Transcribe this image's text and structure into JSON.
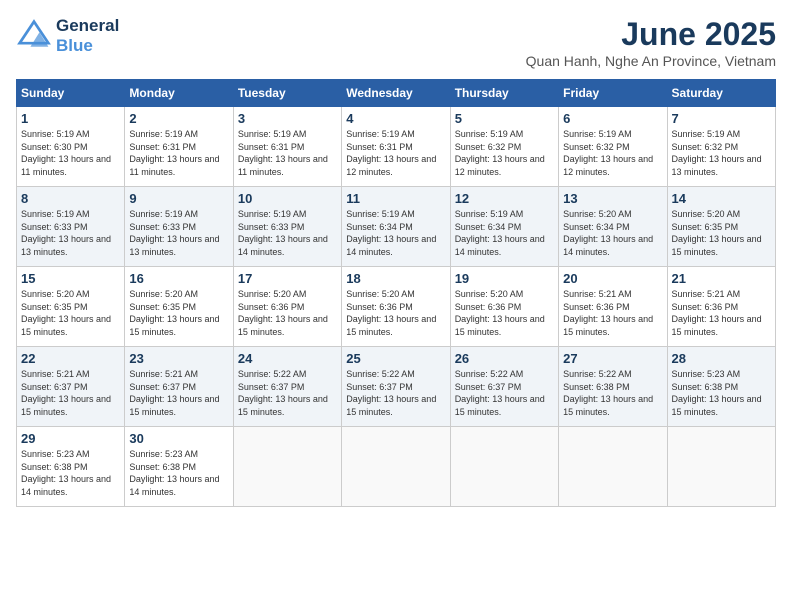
{
  "header": {
    "logo_line1": "General",
    "logo_line2": "Blue",
    "month": "June 2025",
    "location": "Quan Hanh, Nghe An Province, Vietnam"
  },
  "weekdays": [
    "Sunday",
    "Monday",
    "Tuesday",
    "Wednesday",
    "Thursday",
    "Friday",
    "Saturday"
  ],
  "weeks": [
    [
      {
        "day": "1",
        "sunrise": "5:19 AM",
        "sunset": "6:30 PM",
        "daylight": "13 hours and 11 minutes."
      },
      {
        "day": "2",
        "sunrise": "5:19 AM",
        "sunset": "6:31 PM",
        "daylight": "13 hours and 11 minutes."
      },
      {
        "day": "3",
        "sunrise": "5:19 AM",
        "sunset": "6:31 PM",
        "daylight": "13 hours and 11 minutes."
      },
      {
        "day": "4",
        "sunrise": "5:19 AM",
        "sunset": "6:31 PM",
        "daylight": "13 hours and 12 minutes."
      },
      {
        "day": "5",
        "sunrise": "5:19 AM",
        "sunset": "6:32 PM",
        "daylight": "13 hours and 12 minutes."
      },
      {
        "day": "6",
        "sunrise": "5:19 AM",
        "sunset": "6:32 PM",
        "daylight": "13 hours and 12 minutes."
      },
      {
        "day": "7",
        "sunrise": "5:19 AM",
        "sunset": "6:32 PM",
        "daylight": "13 hours and 13 minutes."
      }
    ],
    [
      {
        "day": "8",
        "sunrise": "5:19 AM",
        "sunset": "6:33 PM",
        "daylight": "13 hours and 13 minutes."
      },
      {
        "day": "9",
        "sunrise": "5:19 AM",
        "sunset": "6:33 PM",
        "daylight": "13 hours and 13 minutes."
      },
      {
        "day": "10",
        "sunrise": "5:19 AM",
        "sunset": "6:33 PM",
        "daylight": "13 hours and 14 minutes."
      },
      {
        "day": "11",
        "sunrise": "5:19 AM",
        "sunset": "6:34 PM",
        "daylight": "13 hours and 14 minutes."
      },
      {
        "day": "12",
        "sunrise": "5:19 AM",
        "sunset": "6:34 PM",
        "daylight": "13 hours and 14 minutes."
      },
      {
        "day": "13",
        "sunrise": "5:20 AM",
        "sunset": "6:34 PM",
        "daylight": "13 hours and 14 minutes."
      },
      {
        "day": "14",
        "sunrise": "5:20 AM",
        "sunset": "6:35 PM",
        "daylight": "13 hours and 15 minutes."
      }
    ],
    [
      {
        "day": "15",
        "sunrise": "5:20 AM",
        "sunset": "6:35 PM",
        "daylight": "13 hours and 15 minutes."
      },
      {
        "day": "16",
        "sunrise": "5:20 AM",
        "sunset": "6:35 PM",
        "daylight": "13 hours and 15 minutes."
      },
      {
        "day": "17",
        "sunrise": "5:20 AM",
        "sunset": "6:36 PM",
        "daylight": "13 hours and 15 minutes."
      },
      {
        "day": "18",
        "sunrise": "5:20 AM",
        "sunset": "6:36 PM",
        "daylight": "13 hours and 15 minutes."
      },
      {
        "day": "19",
        "sunrise": "5:20 AM",
        "sunset": "6:36 PM",
        "daylight": "13 hours and 15 minutes."
      },
      {
        "day": "20",
        "sunrise": "5:21 AM",
        "sunset": "6:36 PM",
        "daylight": "13 hours and 15 minutes."
      },
      {
        "day": "21",
        "sunrise": "5:21 AM",
        "sunset": "6:36 PM",
        "daylight": "13 hours and 15 minutes."
      }
    ],
    [
      {
        "day": "22",
        "sunrise": "5:21 AM",
        "sunset": "6:37 PM",
        "daylight": "13 hours and 15 minutes."
      },
      {
        "day": "23",
        "sunrise": "5:21 AM",
        "sunset": "6:37 PM",
        "daylight": "13 hours and 15 minutes."
      },
      {
        "day": "24",
        "sunrise": "5:22 AM",
        "sunset": "6:37 PM",
        "daylight": "13 hours and 15 minutes."
      },
      {
        "day": "25",
        "sunrise": "5:22 AM",
        "sunset": "6:37 PM",
        "daylight": "13 hours and 15 minutes."
      },
      {
        "day": "26",
        "sunrise": "5:22 AM",
        "sunset": "6:37 PM",
        "daylight": "13 hours and 15 minutes."
      },
      {
        "day": "27",
        "sunrise": "5:22 AM",
        "sunset": "6:38 PM",
        "daylight": "13 hours and 15 minutes."
      },
      {
        "day": "28",
        "sunrise": "5:23 AM",
        "sunset": "6:38 PM",
        "daylight": "13 hours and 15 minutes."
      }
    ],
    [
      {
        "day": "29",
        "sunrise": "5:23 AM",
        "sunset": "6:38 PM",
        "daylight": "13 hours and 14 minutes."
      },
      {
        "day": "30",
        "sunrise": "5:23 AM",
        "sunset": "6:38 PM",
        "daylight": "13 hours and 14 minutes."
      },
      null,
      null,
      null,
      null,
      null
    ]
  ]
}
